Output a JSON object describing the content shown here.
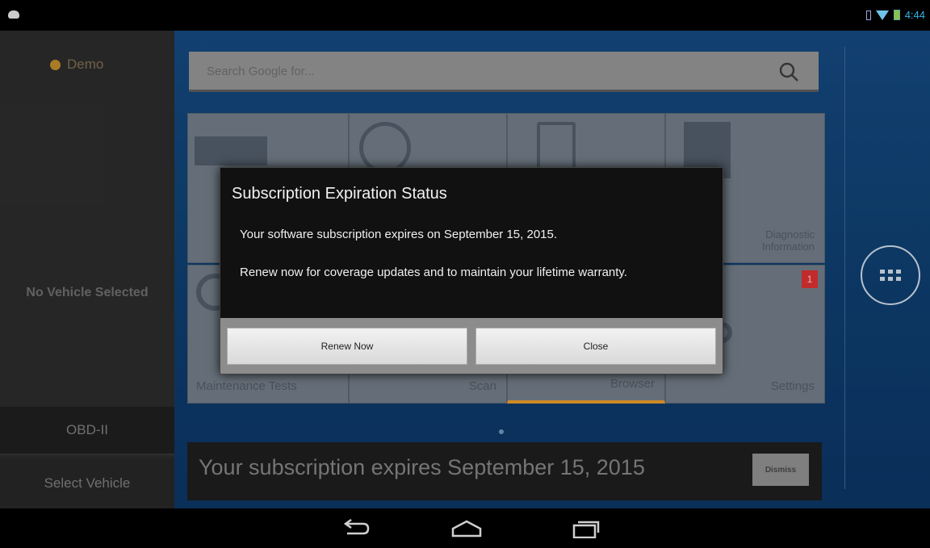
{
  "status_bar": {
    "time": "4:44"
  },
  "left_panel": {
    "demo_label": "Demo",
    "no_vehicle": "No Vehicle Selected",
    "obd_label": "OBD-II",
    "select_vehicle_label": "Select Vehicle"
  },
  "search": {
    "placeholder": "Search Google for..."
  },
  "tiles": {
    "diagnostic_info": "Diagnostic Information",
    "maintenance": "Maintenance Tests",
    "scan": "Scan",
    "browser": "Browser",
    "settings": "Settings",
    "settings_badge": "1"
  },
  "notification": {
    "text": "Your subscription expires September 15, 2015",
    "dismiss_label": "Dismiss"
  },
  "dialog": {
    "title": "Subscription Expiration Status",
    "line1": "Your software subscription expires on September 15, 2015.",
    "line2": "Renew now for coverage updates and to maintain your lifetime warranty.",
    "renew_label": "Renew Now",
    "close_label": "Close"
  },
  "colors": {
    "accent": "#33b5e5",
    "badge": "#d32f2f",
    "browser_underline": "#e0962a"
  }
}
